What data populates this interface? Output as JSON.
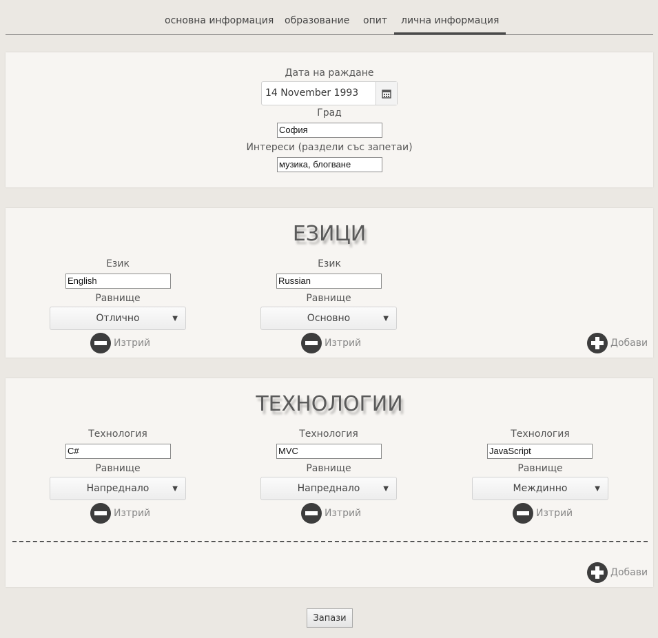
{
  "tabs": [
    "основна информация",
    "образование",
    "опит",
    "лична информация"
  ],
  "personal": {
    "birth_label": "Дата на раждане",
    "birth_value": "14 November 1993",
    "city_label": "Град",
    "city_value": "София",
    "interests_label": "Интереси (раздели със запетаи)",
    "interests_value": "музика, блогване"
  },
  "languages": {
    "heading": "ЕЗИЦИ",
    "field_label": "Език",
    "level_label": "Равнище",
    "remove_label": "Изтрий",
    "add_label": "Добави",
    "items": [
      {
        "name": "English",
        "level": "Отлично"
      },
      {
        "name": "Russian",
        "level": "Основно"
      }
    ]
  },
  "technologies": {
    "heading": "ТЕХНОЛОГИИ",
    "field_label": "Технология",
    "level_label": "Равнище",
    "remove_label": "Изтрий",
    "add_label": "Добави",
    "items": [
      {
        "name": "C#",
        "level": "Напреднало"
      },
      {
        "name": "MVC",
        "level": "Напреднало"
      },
      {
        "name": "JavaScript",
        "level": "Междинно"
      }
    ]
  },
  "save_label": "Запази"
}
